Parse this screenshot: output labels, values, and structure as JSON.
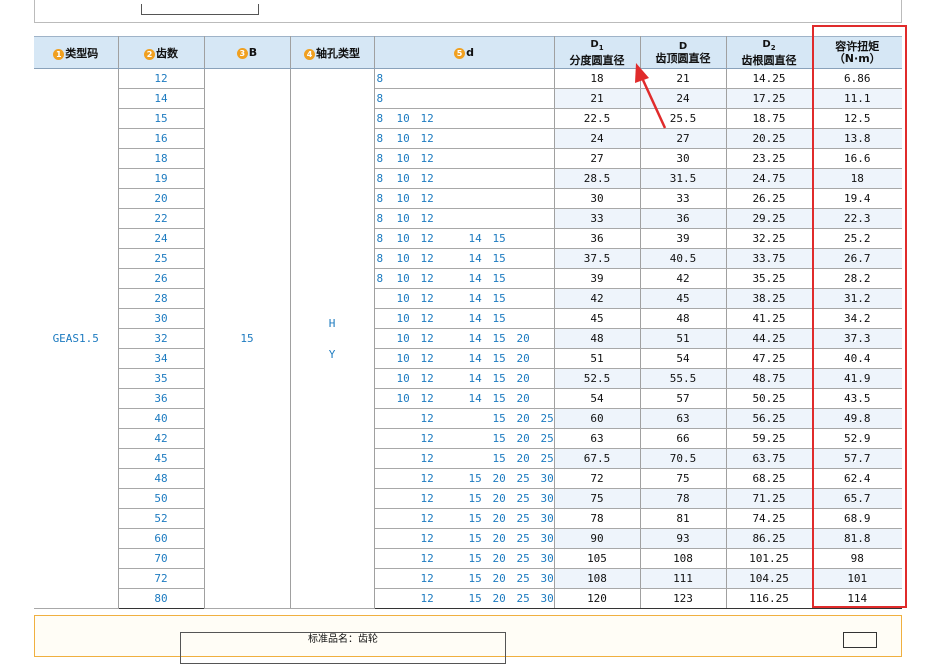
{
  "columns": [
    {
      "num": "1",
      "label": "类型码"
    },
    {
      "num": "2",
      "label": "齿数"
    },
    {
      "num": "3",
      "label": "B"
    },
    {
      "num": "4",
      "label": "轴孔类型"
    },
    {
      "num": "5",
      "label": "d"
    },
    {
      "sym": "D",
      "sub": "1",
      "label": "分度圆直径"
    },
    {
      "sym": "D",
      "sub": "",
      "label": "齿顶圆直径"
    },
    {
      "sym": "D",
      "sub": "2",
      "label": "齿根圆直径"
    },
    {
      "label": "容许扭矩",
      "unit": "（N·m）"
    }
  ],
  "type_code": "GEAS1.5",
  "B": "15",
  "bore_types": [
    "H",
    "Y"
  ],
  "rows": [
    {
      "teeth": "12",
      "d": [
        "8",
        "",
        "",
        "",
        "",
        "",
        "",
        ""
      ],
      "d1": "18",
      "da": "21",
      "df": "14.25",
      "torque": "6.86"
    },
    {
      "teeth": "14",
      "d": [
        "8",
        "",
        "",
        "",
        "",
        "",
        "",
        ""
      ],
      "d1": "21",
      "da": "24",
      "df": "17.25",
      "torque": "11.1"
    },
    {
      "teeth": "15",
      "d": [
        "8",
        "10",
        "12",
        "",
        "",
        "",
        "",
        ""
      ],
      "d1": "22.5",
      "da": "25.5",
      "df": "18.75",
      "torque": "12.5"
    },
    {
      "teeth": "16",
      "d": [
        "8",
        "10",
        "12",
        "",
        "",
        "",
        "",
        ""
      ],
      "d1": "24",
      "da": "27",
      "df": "20.25",
      "torque": "13.8"
    },
    {
      "teeth": "18",
      "d": [
        "8",
        "10",
        "12",
        "",
        "",
        "",
        "",
        ""
      ],
      "d1": "27",
      "da": "30",
      "df": "23.25",
      "torque": "16.6"
    },
    {
      "teeth": "19",
      "d": [
        "8",
        "10",
        "12",
        "",
        "",
        "",
        "",
        ""
      ],
      "d1": "28.5",
      "da": "31.5",
      "df": "24.75",
      "torque": "18"
    },
    {
      "teeth": "20",
      "d": [
        "8",
        "10",
        "12",
        "",
        "",
        "",
        "",
        ""
      ],
      "d1": "30",
      "da": "33",
      "df": "26.25",
      "torque": "19.4"
    },
    {
      "teeth": "22",
      "d": [
        "8",
        "10",
        "12",
        "",
        "",
        "",
        "",
        ""
      ],
      "d1": "33",
      "da": "36",
      "df": "29.25",
      "torque": "22.3"
    },
    {
      "teeth": "24",
      "d": [
        "8",
        "10",
        "12",
        "",
        "14",
        "15",
        "",
        ""
      ],
      "d1": "36",
      "da": "39",
      "df": "32.25",
      "torque": "25.2"
    },
    {
      "teeth": "25",
      "d": [
        "8",
        "10",
        "12",
        "",
        "14",
        "15",
        "",
        ""
      ],
      "d1": "37.5",
      "da": "40.5",
      "df": "33.75",
      "torque": "26.7"
    },
    {
      "teeth": "26",
      "d": [
        "8",
        "10",
        "12",
        "",
        "14",
        "15",
        "",
        ""
      ],
      "d1": "39",
      "da": "42",
      "df": "35.25",
      "torque": "28.2"
    },
    {
      "teeth": "28",
      "d": [
        "",
        "10",
        "12",
        "",
        "14",
        "15",
        "",
        ""
      ],
      "d1": "42",
      "da": "45",
      "df": "38.25",
      "torque": "31.2"
    },
    {
      "teeth": "30",
      "d": [
        "",
        "10",
        "12",
        "",
        "14",
        "15",
        "",
        ""
      ],
      "d1": "45",
      "da": "48",
      "df": "41.25",
      "torque": "34.2"
    },
    {
      "teeth": "32",
      "d": [
        "",
        "10",
        "12",
        "",
        "14",
        "15",
        "20",
        ""
      ],
      "d1": "48",
      "da": "51",
      "df": "44.25",
      "torque": "37.3"
    },
    {
      "teeth": "34",
      "d": [
        "",
        "10",
        "12",
        "",
        "14",
        "15",
        "20",
        ""
      ],
      "d1": "51",
      "da": "54",
      "df": "47.25",
      "torque": "40.4"
    },
    {
      "teeth": "35",
      "d": [
        "",
        "10",
        "12",
        "",
        "14",
        "15",
        "20",
        ""
      ],
      "d1": "52.5",
      "da": "55.5",
      "df": "48.75",
      "torque": "41.9"
    },
    {
      "teeth": "36",
      "d": [
        "",
        "10",
        "12",
        "",
        "14",
        "15",
        "20",
        ""
      ],
      "d1": "54",
      "da": "57",
      "df": "50.25",
      "torque": "43.5"
    },
    {
      "teeth": "40",
      "d": [
        "",
        "",
        "12",
        "",
        "",
        "15",
        "20",
        "25"
      ],
      "d1": "60",
      "da": "63",
      "df": "56.25",
      "torque": "49.8"
    },
    {
      "teeth": "42",
      "d": [
        "",
        "",
        "12",
        "",
        "",
        "15",
        "20",
        "25"
      ],
      "d1": "63",
      "da": "66",
      "df": "59.25",
      "torque": "52.9"
    },
    {
      "teeth": "45",
      "d": [
        "",
        "",
        "12",
        "",
        "",
        "15",
        "20",
        "25"
      ],
      "d1": "67.5",
      "da": "70.5",
      "df": "63.75",
      "torque": "57.7"
    },
    {
      "teeth": "48",
      "d": [
        "",
        "",
        "12",
        "",
        "",
        "15",
        "20",
        "25",
        "30"
      ],
      "d1": "72",
      "da": "75",
      "df": "68.25",
      "torque": "62.4"
    },
    {
      "teeth": "50",
      "d": [
        "",
        "",
        "12",
        "",
        "",
        "15",
        "20",
        "25",
        "30"
      ],
      "d1": "75",
      "da": "78",
      "df": "71.25",
      "torque": "65.7"
    },
    {
      "teeth": "52",
      "d": [
        "",
        "",
        "12",
        "",
        "",
        "15",
        "20",
        "25",
        "30"
      ],
      "d1": "78",
      "da": "81",
      "df": "74.25",
      "torque": "68.9"
    },
    {
      "teeth": "60",
      "d": [
        "",
        "",
        "12",
        "",
        "",
        "15",
        "20",
        "25",
        "30"
      ],
      "d1": "90",
      "da": "93",
      "df": "86.25",
      "torque": "81.8"
    },
    {
      "teeth": "70",
      "d": [
        "",
        "",
        "12",
        "",
        "",
        "15",
        "20",
        "25",
        "30"
      ],
      "d1": "105",
      "da": "108",
      "df": "101.25",
      "torque": "98"
    },
    {
      "teeth": "72",
      "d": [
        "",
        "",
        "12",
        "",
        "",
        "15",
        "20",
        "25",
        "30"
      ],
      "d1": "108",
      "da": "111",
      "df": "104.25",
      "torque": "101"
    },
    {
      "teeth": "80",
      "d": [
        "",
        "",
        "12",
        "",
        "",
        "15",
        "20",
        "25",
        "30"
      ],
      "d1": "120",
      "da": "123",
      "df": "116.25",
      "torque": "114"
    }
  ],
  "bottom_label": "标准品名：齿轮"
}
